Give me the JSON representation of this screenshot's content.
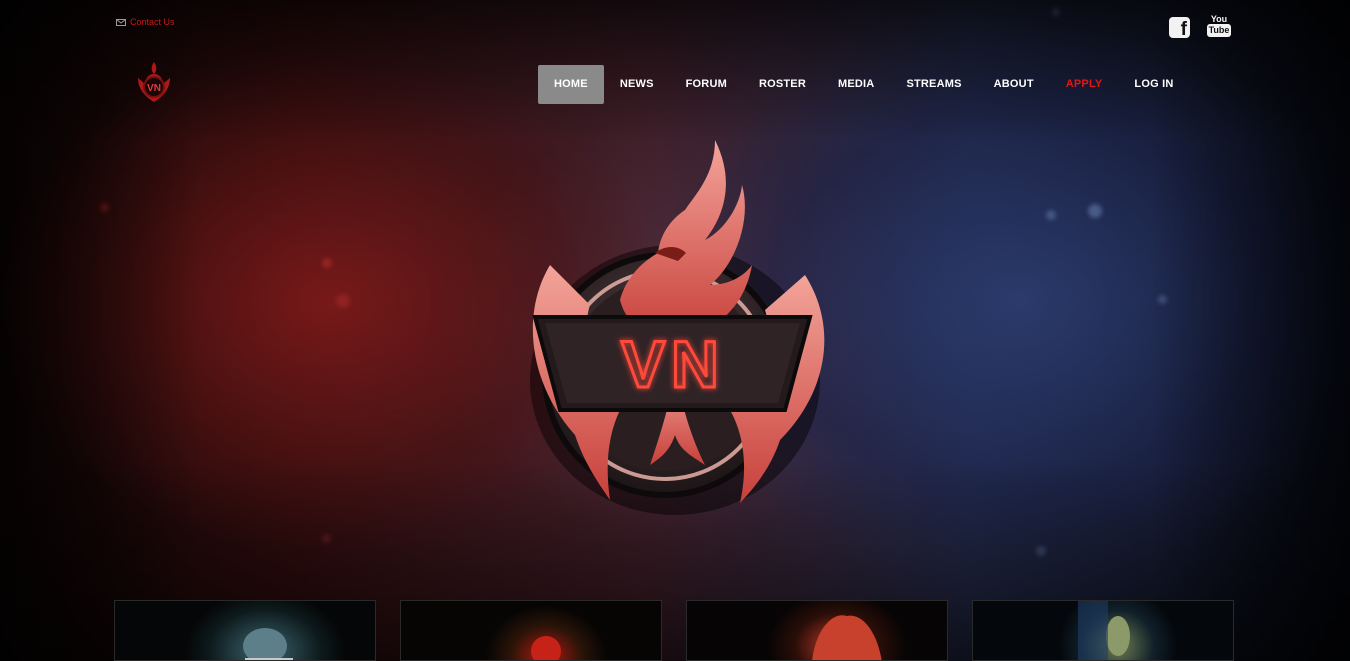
{
  "topbar": {
    "contact_label": "Contact Us",
    "mail_icon": "mail-icon",
    "social": {
      "facebook_glyph": "f",
      "youtube_top": "You",
      "youtube_bottom": "Tube"
    }
  },
  "brand": {
    "logo_text": "VN",
    "accent_color": "#e0161b"
  },
  "nav": {
    "items": [
      {
        "label": "HOME",
        "active": true
      },
      {
        "label": "NEWS"
      },
      {
        "label": "FORUM"
      },
      {
        "label": "ROSTER"
      },
      {
        "label": "MEDIA"
      },
      {
        "label": "STREAMS"
      },
      {
        "label": "ABOUT"
      },
      {
        "label": "APPLY",
        "highlight": true
      },
      {
        "label": "LOG IN"
      }
    ]
  },
  "cards": {
    "count_visible": 4
  }
}
